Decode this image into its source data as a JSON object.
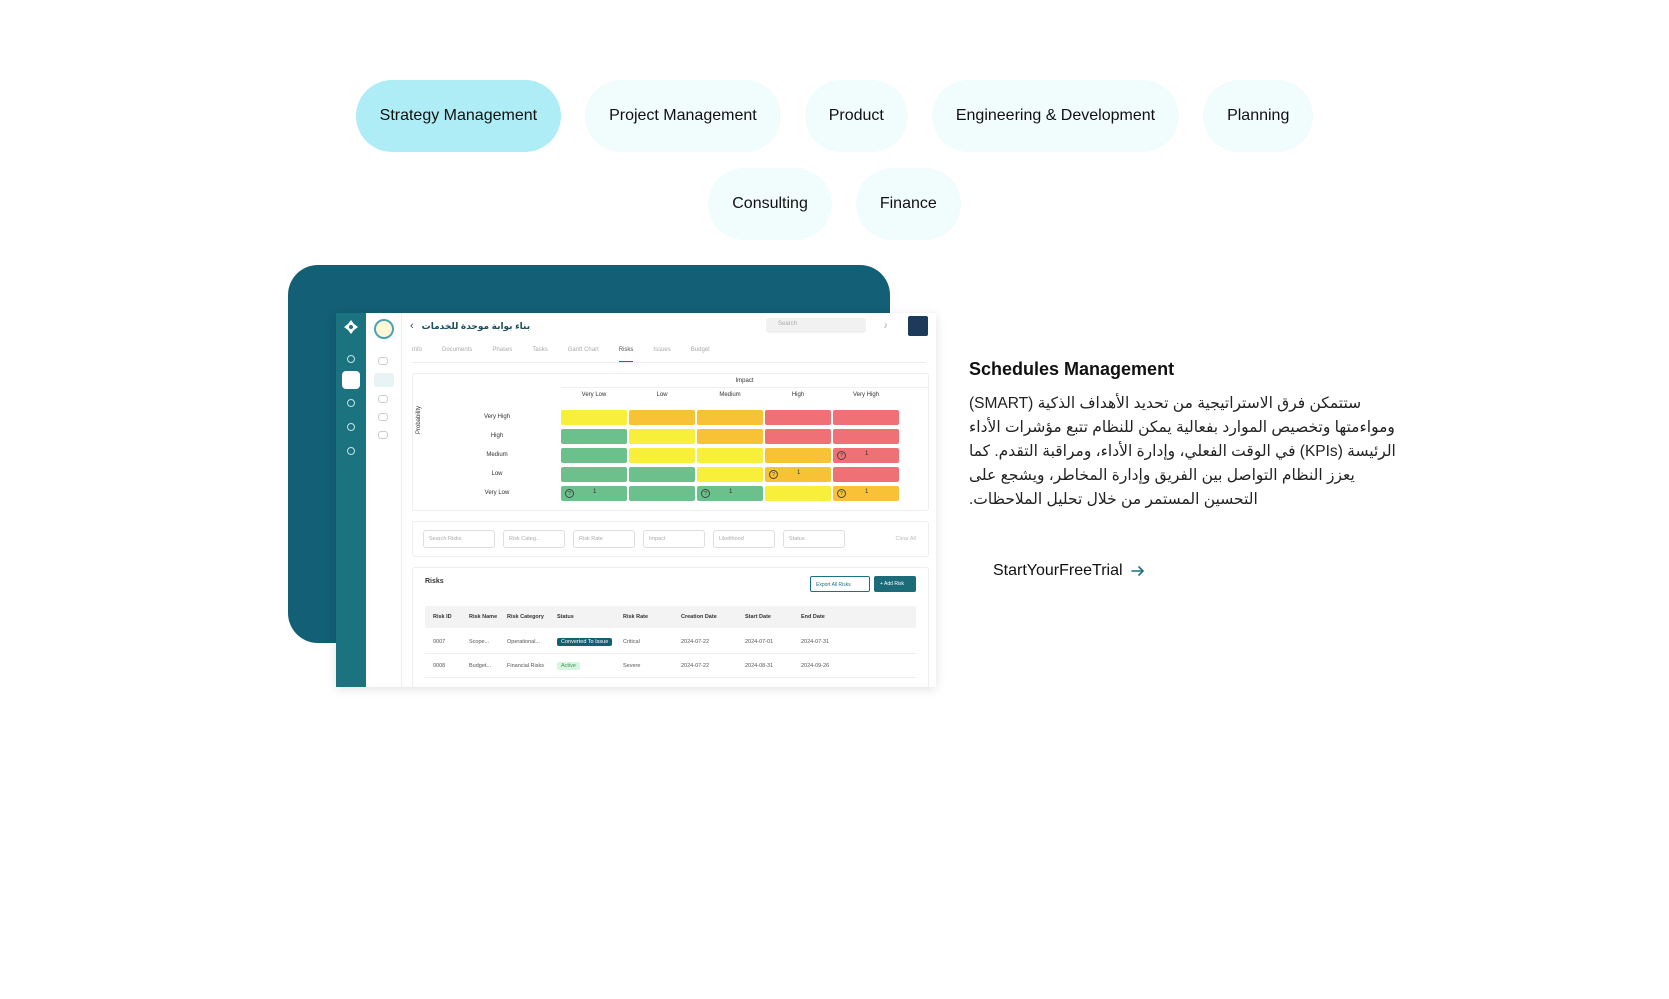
{
  "categories": {
    "items": [
      {
        "label": "Strategy Management",
        "active": true
      },
      {
        "label": "Project Management",
        "active": false
      },
      {
        "label": "Product",
        "active": false
      },
      {
        "label": "Engineering & Development",
        "active": false
      },
      {
        "label": "Planning",
        "active": false
      },
      {
        "label": "Consulting",
        "active": false
      },
      {
        "label": "Finance",
        "active": false
      }
    ],
    "active_color": "#aeedf5",
    "inactive_color": "#f1fcfd"
  },
  "screenshot": {
    "page_title": "بناء بوابة موحدة للخدمات",
    "search_placeholder": "Search",
    "tabs": [
      "Info",
      "Documents",
      "Phases",
      "Tasks",
      "Gantt Chart",
      "Risks",
      "Issues",
      "Budget"
    ],
    "selected_tab": "Risks",
    "matrix": {
      "impact_label": "Impact",
      "probability_label": "Probability",
      "columns": [
        "Very Low",
        "Low",
        "Medium",
        "High",
        "Very High"
      ],
      "rows": [
        "Very High",
        "High",
        "Medium",
        "Low",
        "Very Low"
      ],
      "cells": [
        [
          "yellow",
          "orange",
          "orange",
          "red",
          "red"
        ],
        [
          "green",
          "yellow",
          "orange",
          "red",
          "red"
        ],
        [
          "green",
          "yellow",
          "yellow",
          "orange",
          "red"
        ],
        [
          "green",
          "green",
          "yellow",
          "orange",
          "red"
        ],
        [
          "green",
          "green",
          "green",
          "yellow",
          "orange"
        ]
      ],
      "counts": [
        {
          "row": 2,
          "col": 4,
          "value": "1"
        },
        {
          "row": 3,
          "col": 3,
          "value": "1"
        },
        {
          "row": 4,
          "col": 0,
          "value": "1"
        },
        {
          "row": 4,
          "col": 2,
          "value": "1"
        },
        {
          "row": 4,
          "col": 4,
          "value": "1"
        }
      ],
      "colors": {
        "green": "#6cc08b",
        "yellow": "#f7ef3a",
        "orange": "#f8c236",
        "red": "#ef7176"
      }
    },
    "filters": [
      "Search Risks",
      "Risk Categ...",
      "Risk Rate",
      "Impact",
      "Likelihood",
      "Status"
    ],
    "clear_all": "Clear All",
    "risks": {
      "title": "Risks",
      "export_label": "Export All Risks",
      "add_label": "+ Add Risk",
      "columns": [
        "Risk ID",
        "Risk Name",
        "Risk Category",
        "Status",
        "Risk Rate",
        "Creation Date",
        "Start Date",
        "End Date"
      ],
      "rows": [
        [
          "0007",
          "Scope...",
          "Operational...",
          "Converted To Issue",
          "Critical",
          "2024-07-22",
          "2024-07-01",
          "2024-07-31"
        ],
        [
          "0008",
          "Budget...",
          "Financial Risks",
          "Active",
          "Severe",
          "2024-07-22",
          "2024-08-31",
          "2024-09-26"
        ]
      ]
    }
  },
  "feature": {
    "title": "Schedules Management",
    "description": "ستتمكن فرق الاستراتيجية من تحديد الأهداف الذكية (SMART) ومواءمتها وتخصيص الموارد بفعالية يمكن للنظام تتبع مؤشرات الأداء الرئيسة (KPIs) في الوقت الفعلي، وإدارة الأداء، ومراقبة التقدم. كما يعزز النظام التواصل بين الفريق وإدارة المخاطر، ويشجع على التحسين المستمر من خلال تحليل الملاحظات.",
    "cta_label": "StartYourFreeTrial",
    "cta_icon": "arrow-right-icon"
  },
  "brand": {
    "teal": "#135f75",
    "arrow": "#1c7380"
  }
}
